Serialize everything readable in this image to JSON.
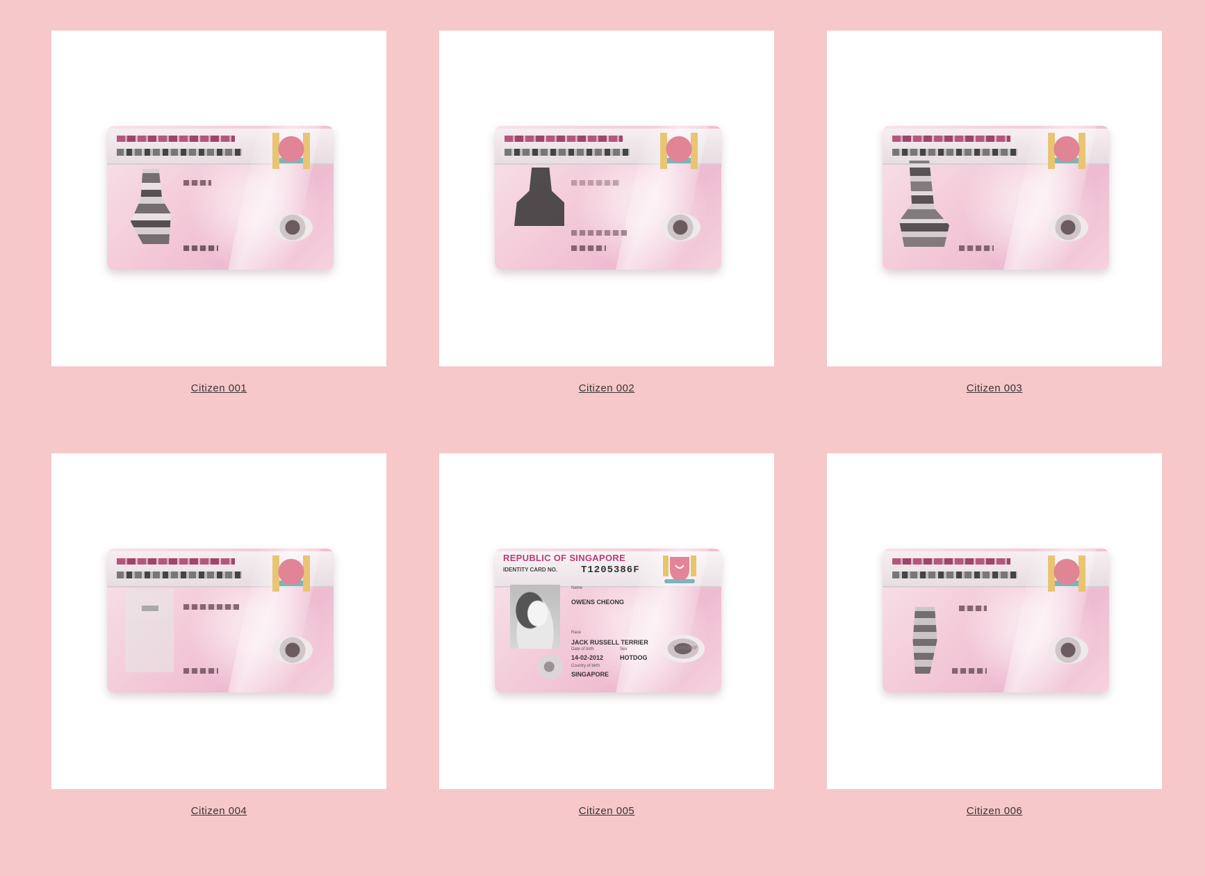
{
  "gallery": {
    "items": [
      {
        "caption": "Citizen 001"
      },
      {
        "caption": "Citizen 002"
      },
      {
        "caption": "Citizen 003"
      },
      {
        "caption": "Citizen 004"
      },
      {
        "caption": "Citizen 005"
      },
      {
        "caption": "Citizen 006"
      }
    ]
  },
  "card_005": {
    "title": "REPUBLIC OF SINGAPORE",
    "id_label": "IDENTITY CARD NO.",
    "id_number": "T1205386F",
    "name_label": "Name",
    "name": "OWENS CHEONG",
    "race_label": "Race",
    "race": "JACK RUSSELL TERRIER",
    "dob_label": "Date of birth",
    "dob": "14-02-2012",
    "sex_label": "Sex",
    "sex": "HOTDOG",
    "country_label": "Country of birth",
    "country": "SINGAPORE",
    "chip_text": "T1205386F"
  },
  "colors": {
    "background": "#f6c8c9",
    "tile": "#ffffff",
    "caption": "#3a3336",
    "card_title": "#b3407a"
  }
}
